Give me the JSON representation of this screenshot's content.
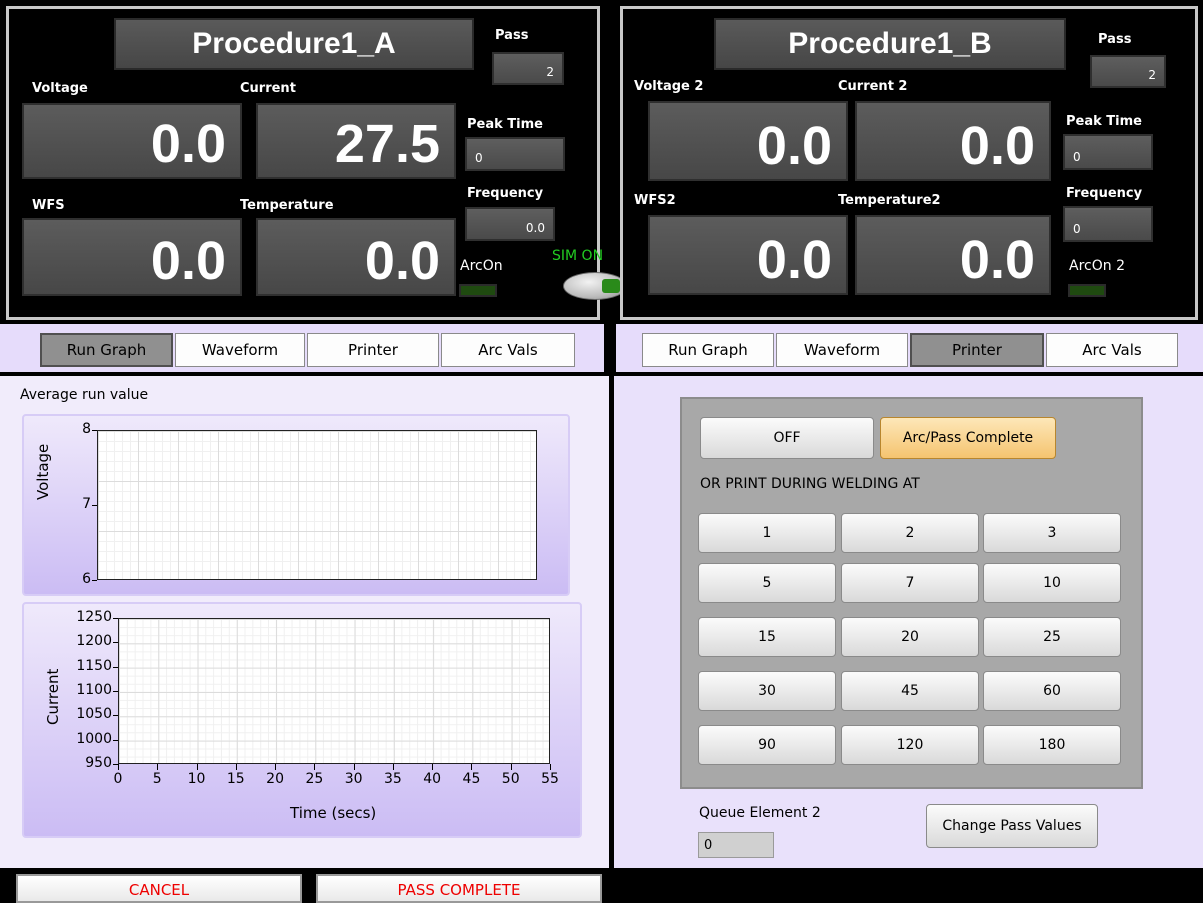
{
  "panel_a": {
    "title": "Procedure1_A",
    "pass_label": "Pass",
    "pass_value": "2",
    "voltage_label": "Voltage",
    "voltage_value": "0.0",
    "current_label": "Current",
    "current_value": "27.5",
    "peak_time_label": "Peak Time",
    "peak_time_value": "0",
    "frequency_label": "Frequency",
    "frequency_value": "0.0",
    "wfs_label": "WFS",
    "wfs_value": "0.0",
    "temperature_label": "Temperature",
    "temperature_value": "0.0",
    "arcon_label": "ArcOn"
  },
  "sim": {
    "label": "SIM ON"
  },
  "panel_b": {
    "title": "Procedure1_B",
    "pass_label": "Pass",
    "pass_value": "2",
    "voltage_label": "Voltage 2",
    "voltage_value": "0.0",
    "current_label": "Current 2",
    "current_value": "0.0",
    "peak_time_label": "Peak Time",
    "peak_time_value": "0",
    "frequency_label": "Frequency",
    "frequency_value": "0",
    "wfs_label": "WFS2",
    "wfs_value": "0.0",
    "temperature_label": "Temperature2",
    "temperature_value": "0.0",
    "arcon_label": "ArcOn 2"
  },
  "tabs_left": {
    "items": [
      "Run Graph",
      "Waveform",
      "Printer",
      "Arc Vals"
    ],
    "selected": "Run Graph"
  },
  "tabs_right": {
    "items": [
      "Run Graph",
      "Waveform",
      "Printer",
      "Arc Vals"
    ],
    "selected": "Printer"
  },
  "graphs": {
    "section_title": "Average run value",
    "voltage": {
      "ylabel": "Voltage",
      "yticks": [
        "8",
        "7",
        "6"
      ]
    },
    "current": {
      "ylabel": "Current",
      "yticks": [
        "1250",
        "1200",
        "1150",
        "1100",
        "1050",
        "1000",
        "950"
      ],
      "xlabel": "Time (secs)",
      "xticks": [
        "0",
        "5",
        "10",
        "15",
        "20",
        "25",
        "30",
        "35",
        "40",
        "45",
        "50",
        "55"
      ]
    }
  },
  "chart_data": [
    {
      "type": "line",
      "ylabel": "Voltage",
      "ylim": [
        6,
        8
      ],
      "xlim": [
        0,
        55
      ],
      "series": [],
      "grid": true
    },
    {
      "type": "line",
      "ylabel": "Current",
      "xlabel": "Time (secs)",
      "ylim": [
        950,
        1250
      ],
      "xlim": [
        0,
        55
      ],
      "series": [],
      "grid": true
    }
  ],
  "printer": {
    "off_label": "OFF",
    "arc_pass_label": "Arc/Pass Complete",
    "print_during_label": "OR PRINT DURING WELDING AT",
    "intervals": [
      "1",
      "2",
      "3",
      "5",
      "7",
      "10",
      "15",
      "20",
      "25",
      "30",
      "45",
      "60",
      "90",
      "120",
      "180"
    ],
    "queue_label": "Queue Element 2",
    "queue_value": "0",
    "change_pass_label": "Change Pass Values"
  },
  "footer": {
    "cancel_label": "CANCEL",
    "pass_complete_label": "PASS COMPLETE"
  },
  "colors": {
    "sim_text": "#22cc22",
    "cancel_text": "#ee0000",
    "highlight_button": "#f5c470",
    "tab_bar": "#e6dcfb"
  }
}
